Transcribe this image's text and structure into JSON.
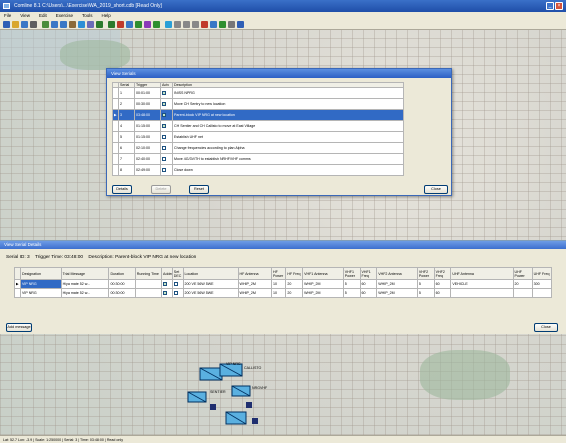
{
  "window": {
    "title": "Comline 8.1 C:\\Users\\...\\Exercise\\WA_2019_short.cdb [Read Only]",
    "icon": "app-icon"
  },
  "menubar": {
    "items": [
      "File",
      "View",
      "Edit",
      "Exercise",
      "Tools",
      "Help"
    ]
  },
  "toolbar": {
    "icons": [
      "new-icon",
      "open-icon",
      "save-icon",
      "print-icon",
      "pointer-icon",
      "zoom-in-icon",
      "zoom-out-icon",
      "pan-icon",
      "globe-icon",
      "layers-icon",
      "back-icon",
      "forward-icon",
      "flag-icon",
      "grid-icon",
      "table-icon",
      "chart-icon",
      "check-icon",
      "cycle-icon",
      "play-icon",
      "pause-icon",
      "stop-icon",
      "record-icon",
      "refresh-icon",
      "map-icon",
      "settings-icon",
      "help-icon"
    ],
    "colors": [
      "#2f5fb5",
      "#d9a62e",
      "#3a78c6",
      "#5e5e5e",
      "#4b8c3a",
      "#3a78c6",
      "#3a78c6",
      "#8a6a3a",
      "#2d8fd6",
      "#6b6bb8",
      "#2c7a2c",
      "#2c7a2c",
      "#c03a2b",
      "#3a78c6",
      "#2f8f2f",
      "#8c3ab8",
      "#2f8f2f",
      "#2a9fd6",
      "#888888",
      "#888888",
      "#888888",
      "#c03a2b",
      "#3a78c6",
      "#2f8f2f",
      "#777777",
      "#2f5fb5"
    ]
  },
  "view_serials": {
    "title": "View Serials",
    "columns": [
      "",
      "Serial",
      "Trigger",
      "Actv",
      "Description"
    ],
    "rows": [
      {
        "serial": "1",
        "trigger": "00:01:00",
        "active": true,
        "description": "INISS NPRG",
        "selected": false,
        "pointer": ""
      },
      {
        "serial": "2",
        "trigger": "00:30:00",
        "active": true,
        "description": "Move CH Sentry to new location",
        "selected": false,
        "pointer": ""
      },
      {
        "serial": "3",
        "trigger": "03:48:00",
        "active": true,
        "description": "Parent-block VIP NRG at new location",
        "selected": true,
        "pointer": "▶"
      },
      {
        "serial": "4",
        "trigger": "01:15:00",
        "active": true,
        "description": "CH Sentier and CH Callisto to move at East Village",
        "selected": false,
        "pointer": ""
      },
      {
        "serial": "5",
        "trigger": "01:15:00",
        "active": false,
        "description": "Establish UHF net",
        "selected": false,
        "pointer": ""
      },
      {
        "serial": "6",
        "trigger": "02:10:00",
        "active": false,
        "description": "Change frequencies according to plan Alpha",
        "selected": false,
        "pointer": ""
      },
      {
        "serial": "7",
        "trigger": "02:40:00",
        "active": false,
        "description": "Move 4G/3V/TH to establish NRHF/VHF comms",
        "selected": false,
        "pointer": ""
      },
      {
        "serial": "8",
        "trigger": "02:49:00",
        "active": false,
        "description": "Close down",
        "selected": false,
        "pointer": ""
      }
    ],
    "buttons": {
      "details": "Details",
      "delete": "Delete",
      "reset": "Reset",
      "close": "Close"
    }
  },
  "serial_details": {
    "panel_title": "View Serial Details",
    "serial_label": "Serial ID: 3",
    "trigger_label": "Trigger Time: 03:48:00",
    "description_label": "Description: Parent-block VIP NRG at new location",
    "columns": [
      "",
      "Designation",
      "Trial Message",
      "Duration",
      "Running Time",
      "Added",
      "Set DEC",
      "Location",
      "HF Antenna",
      "HF Power",
      "HF Freq",
      "VHF1 Antenna",
      "VHF1 Power",
      "VHF1 Freq",
      "VHF2 Antenna",
      "VHF2 Power",
      "VHF2 Freq",
      "UHF Antenna",
      "UHF Power",
      "UHF Freq"
    ],
    "rows": [
      {
        "pointer": "▶",
        "designation": "VIP NRG",
        "trial_message": "Hiya mate 52 w...",
        "duration": "00:30:00",
        "running": "",
        "added": true,
        "set_dec": false,
        "location": "200 VE 56W 5WE",
        "hf_ant": "WHIP_2M",
        "hf_pwr": "10",
        "hf_freq": "20",
        "vhf1_ant": "WHIP_2M",
        "vhf1_pwr": "5",
        "vhf1_freq": "60",
        "vhf2_ant": "WHIP_2M",
        "vhf2_pwr": "5",
        "vhf2_freq": "60",
        "uhf_ant": "VEHICLE",
        "uhf_pwr": "20",
        "uhf_freq": "300",
        "selected": true
      },
      {
        "pointer": "",
        "designation": "VIP NRG",
        "trial_message": "Hiya mate 52 w...",
        "duration": "00:30:00",
        "running": "",
        "added": true,
        "set_dec": false,
        "location": "200 VE 56W 5WE",
        "hf_ant": "WHIP_2M",
        "hf_pwr": "10",
        "hf_freq": "20",
        "vhf1_ant": "WHIP_2M",
        "vhf1_pwr": "5",
        "vhf1_freq": "60",
        "vhf2_ant": "WHIP_2M",
        "vhf2_pwr": "5",
        "vhf2_freq": "60",
        "uhf_ant": "",
        "uhf_pwr": "",
        "uhf_freq": "",
        "selected": false
      }
    ],
    "buttons": {
      "add_message": "Add message",
      "close": "Close"
    }
  },
  "map": {
    "labels": [
      "CALLISTO",
      "SENTIER",
      "NRGVHF",
      "VIP NRG"
    ]
  },
  "statusbar": {
    "text": "Lat: 52.7   Lon: -3.9 | Scale: 1:250000 | Serial: 3 | Time: 03:48:00 | Read only"
  }
}
